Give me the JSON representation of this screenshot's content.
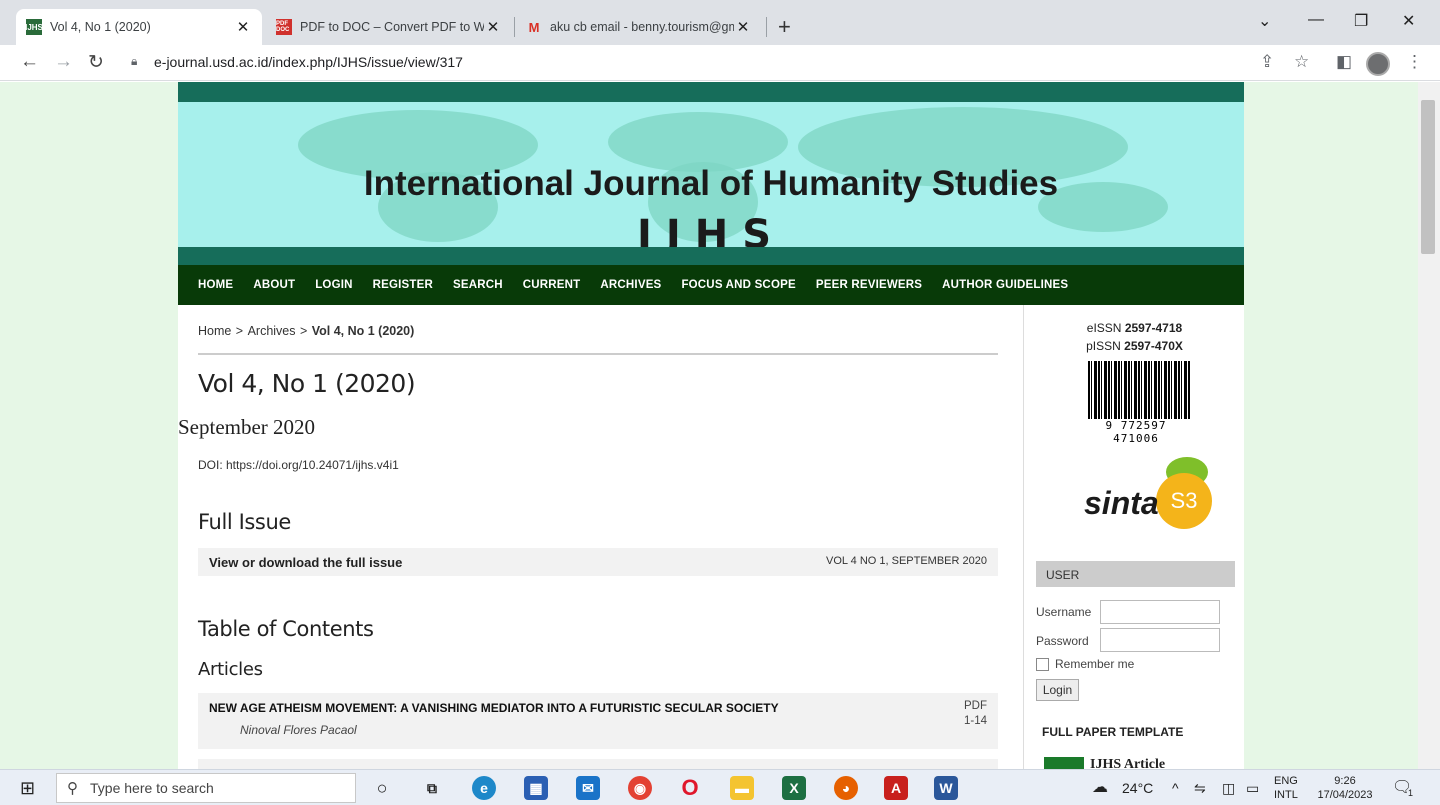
{
  "browser": {
    "tabs": [
      {
        "favicon": "IJHS",
        "title": "Vol 4, No 1 (2020)"
      },
      {
        "favicon": "PDF DOC",
        "title": "PDF to DOC – Convert PDF to Wo"
      },
      {
        "favicon": "M",
        "title": "aku cb email - benny.tourism@gm"
      }
    ],
    "url": "e-journal.usd.ac.id/index.php/IJHS/issue/view/317"
  },
  "journal": {
    "title": "International Journal of Humanity Studies",
    "abbr": "IJHS",
    "menu": [
      "HOME",
      "ABOUT",
      "LOGIN",
      "REGISTER",
      "SEARCH",
      "CURRENT",
      "ARCHIVES",
      "FOCUS AND SCOPE",
      "PEER REVIEWERS",
      "AUTHOR GUIDELINES"
    ]
  },
  "breadcrumb": {
    "home": "Home",
    "sep": ">",
    "archives": "Archives",
    "current": "Vol 4, No 1 (2020)"
  },
  "issue": {
    "title": "Vol 4, No 1 (2020)",
    "date": "September 2020",
    "doi": "DOI: https://doi.org/10.24071/ijhs.v4i1",
    "full_issue_heading": "Full Issue",
    "full_issue_link": "View or download the full issue",
    "full_issue_meta": "VOL 4 NO 1, SEPTEMBER 2020",
    "toc_heading": "Table of Contents",
    "section": "Articles",
    "articles": [
      {
        "title": "NEW AGE ATHEISM MOVEMENT: A VANISHING MEDIATOR INTO A FUTURISTIC SECULAR SOCIETY",
        "author": "Ninoval Flores Pacaol",
        "format": "PDF",
        "pages": "1-14"
      }
    ]
  },
  "sidebar": {
    "eissn_label": "eISSN",
    "eissn": "2597-4718",
    "pissn_label": "pISSN",
    "pissn": "2597-470X",
    "barcode_number": "9 772597 471006",
    "sinta_text": "sinta",
    "sinta_level": "S3",
    "user_heading": "USER",
    "username_label": "Username",
    "password_label": "Password",
    "remember_label": "Remember me",
    "login_button": "Login",
    "template_heading": "FULL PAPER TEMPLATE",
    "template_link": "IJHS Article"
  },
  "taskbar": {
    "search_placeholder": "Type here to search",
    "weather": "24°C",
    "lang1": "ENG",
    "lang2": "INTL",
    "time": "9:26",
    "date": "17/04/2023",
    "notif_count": "1"
  },
  "colors": {
    "menu_bg": "#083a08",
    "banner_dark": "#166d5a",
    "banner_light": "#a7f0ec",
    "page_bg": "#e6f7e6"
  }
}
